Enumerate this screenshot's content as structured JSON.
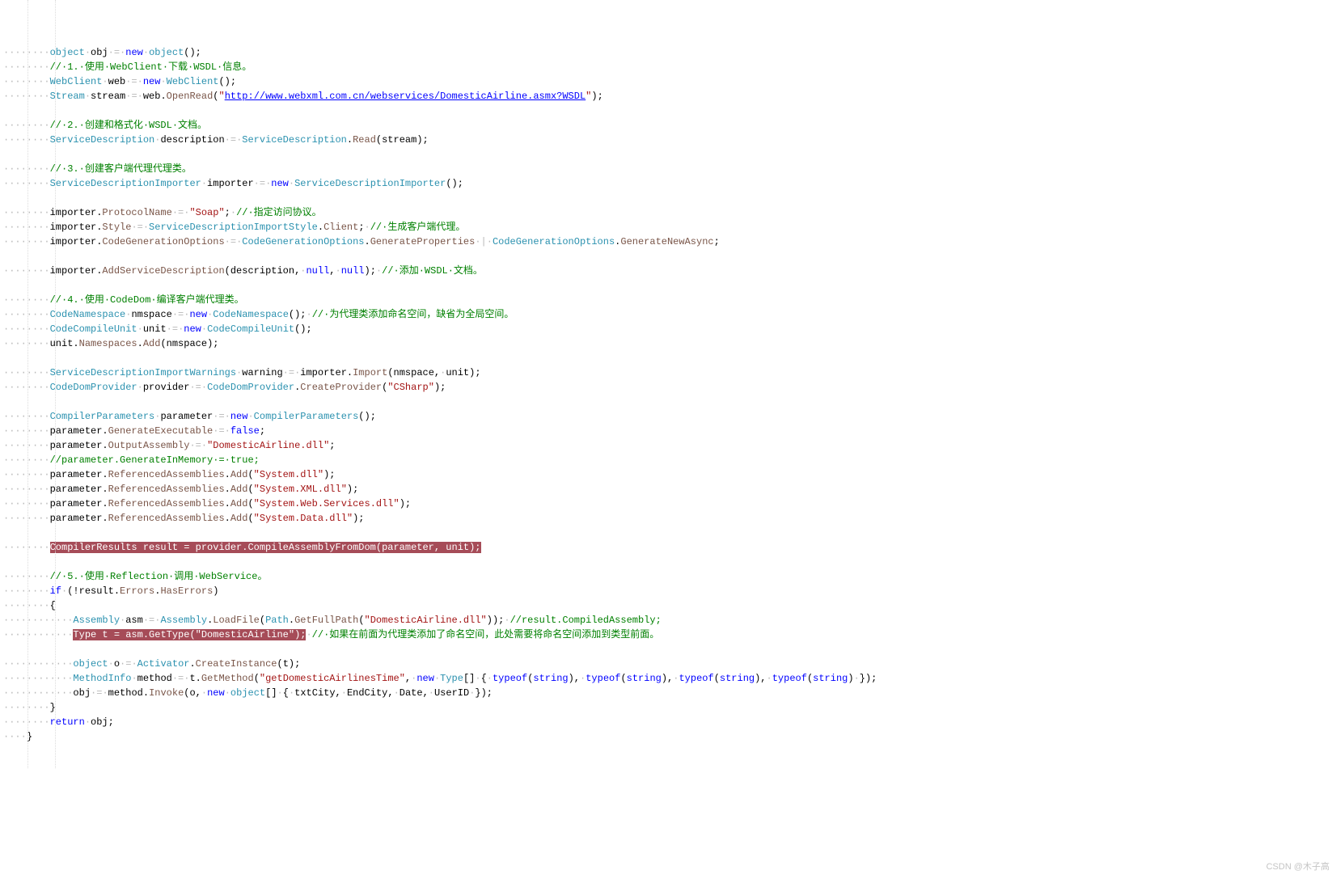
{
  "watermark": "CSDN @木子高",
  "lines": [
    [
      [
        "ws",
        "········"
      ],
      [
        "ty",
        "object"
      ],
      [
        "ws",
        "·"
      ],
      [
        "id",
        "obj"
      ],
      [
        "ws",
        "·="
      ],
      [
        "ws",
        "·"
      ],
      [
        "kw",
        "new"
      ],
      [
        "ws",
        "·"
      ],
      [
        "ty",
        "object"
      ],
      [
        "id",
        "();"
      ]
    ],
    [
      [
        "ws",
        "········"
      ],
      [
        "cm",
        "//·1.·使用·WebClient·下载·WSDL·信息。"
      ]
    ],
    [
      [
        "ws",
        "········"
      ],
      [
        "ty",
        "WebClient"
      ],
      [
        "ws",
        "·"
      ],
      [
        "id",
        "web"
      ],
      [
        "ws",
        "·="
      ],
      [
        "ws",
        "·"
      ],
      [
        "kw",
        "new"
      ],
      [
        "ws",
        "·"
      ],
      [
        "ty",
        "WebClient"
      ],
      [
        "id",
        "();"
      ]
    ],
    [
      [
        "ws",
        "········"
      ],
      [
        "ty",
        "Stream"
      ],
      [
        "ws",
        "·"
      ],
      [
        "id",
        "stream"
      ],
      [
        "ws",
        "·="
      ],
      [
        "ws",
        "·"
      ],
      [
        "id",
        "web."
      ],
      [
        "fn",
        "OpenRead"
      ],
      [
        "id",
        "("
      ],
      [
        "str",
        "\""
      ],
      [
        "url",
        "http://www.webxml.com.cn/webservices/DomesticAirline.asmx?WSDL"
      ],
      [
        "str",
        "\""
      ],
      [
        "id",
        ");"
      ]
    ],
    [
      [
        "ws",
        " "
      ]
    ],
    [
      [
        "ws",
        "········"
      ],
      [
        "cm",
        "//·2.·创建和格式化·WSDL·文档。"
      ]
    ],
    [
      [
        "ws",
        "········"
      ],
      [
        "ty",
        "ServiceDescription"
      ],
      [
        "ws",
        "·"
      ],
      [
        "id",
        "description"
      ],
      [
        "ws",
        "·="
      ],
      [
        "ws",
        "·"
      ],
      [
        "ty",
        "ServiceDescription"
      ],
      [
        "id",
        "."
      ],
      [
        "fn",
        "Read"
      ],
      [
        "id",
        "(stream);"
      ]
    ],
    [
      [
        "ws",
        " "
      ]
    ],
    [
      [
        "ws",
        "········"
      ],
      [
        "cm",
        "//·3.·创建客户端代理代理类。"
      ]
    ],
    [
      [
        "ws",
        "········"
      ],
      [
        "ty",
        "ServiceDescriptionImporter"
      ],
      [
        "ws",
        "·"
      ],
      [
        "id",
        "importer"
      ],
      [
        "ws",
        "·="
      ],
      [
        "ws",
        "·"
      ],
      [
        "kw",
        "new"
      ],
      [
        "ws",
        "·"
      ],
      [
        "ty",
        "ServiceDescriptionImporter"
      ],
      [
        "id",
        "();"
      ]
    ],
    [
      [
        "ws",
        " "
      ]
    ],
    [
      [
        "ws",
        "········"
      ],
      [
        "id",
        "importer."
      ],
      [
        "fn",
        "ProtocolName"
      ],
      [
        "ws",
        "·="
      ],
      [
        "ws",
        "·"
      ],
      [
        "str",
        "\"Soap\""
      ],
      [
        "id",
        ";"
      ],
      [
        "ws",
        "·"
      ],
      [
        "cm",
        "//·指定访问协议。"
      ]
    ],
    [
      [
        "ws",
        "········"
      ],
      [
        "id",
        "importer."
      ],
      [
        "fn",
        "Style"
      ],
      [
        "ws",
        "·="
      ],
      [
        "ws",
        "·"
      ],
      [
        "ty",
        "ServiceDescriptionImportStyle"
      ],
      [
        "id",
        "."
      ],
      [
        "fn",
        "Client"
      ],
      [
        "id",
        ";"
      ],
      [
        "ws",
        "·"
      ],
      [
        "cm",
        "//·生成客户端代理。"
      ]
    ],
    [
      [
        "ws",
        "········"
      ],
      [
        "id",
        "importer."
      ],
      [
        "fn",
        "CodeGenerationOptions"
      ],
      [
        "ws",
        "·="
      ],
      [
        "ws",
        "·"
      ],
      [
        "ty",
        "CodeGenerationOptions"
      ],
      [
        "id",
        "."
      ],
      [
        "fn",
        "GenerateProperties"
      ],
      [
        "ws",
        "·|·"
      ],
      [
        "ty",
        "CodeGenerationOptions"
      ],
      [
        "id",
        "."
      ],
      [
        "fn",
        "GenerateNewAsync"
      ],
      [
        "id",
        ";"
      ]
    ],
    [
      [
        "ws",
        " "
      ]
    ],
    [
      [
        "ws",
        "········"
      ],
      [
        "id",
        "importer."
      ],
      [
        "fn",
        "AddServiceDescription"
      ],
      [
        "id",
        "(description,"
      ],
      [
        "ws",
        "·"
      ],
      [
        "kw",
        "null"
      ],
      [
        "id",
        ","
      ],
      [
        "ws",
        "·"
      ],
      [
        "kw",
        "null"
      ],
      [
        "id",
        ");"
      ],
      [
        "ws",
        "·"
      ],
      [
        "cm",
        "//·添加·WSDL·文档。"
      ]
    ],
    [
      [
        "ws",
        " "
      ]
    ],
    [
      [
        "ws",
        "········"
      ],
      [
        "cm",
        "//·4.·使用·CodeDom·编译客户端代理类。"
      ]
    ],
    [
      [
        "ws",
        "········"
      ],
      [
        "ty",
        "CodeNamespace"
      ],
      [
        "ws",
        "·"
      ],
      [
        "id",
        "nmspace"
      ],
      [
        "ws",
        "·="
      ],
      [
        "ws",
        "·"
      ],
      [
        "kw",
        "new"
      ],
      [
        "ws",
        "·"
      ],
      [
        "ty",
        "CodeNamespace"
      ],
      [
        "id",
        "();"
      ],
      [
        "ws",
        "·"
      ],
      [
        "cm",
        "//·为代理类添加命名空间，缺省为全局空间。"
      ]
    ],
    [
      [
        "ws",
        "········"
      ],
      [
        "ty",
        "CodeCompileUnit"
      ],
      [
        "ws",
        "·"
      ],
      [
        "id",
        "unit"
      ],
      [
        "ws",
        "·="
      ],
      [
        "ws",
        "·"
      ],
      [
        "kw",
        "new"
      ],
      [
        "ws",
        "·"
      ],
      [
        "ty",
        "CodeCompileUnit"
      ],
      [
        "id",
        "();"
      ]
    ],
    [
      [
        "ws",
        "········"
      ],
      [
        "id",
        "unit."
      ],
      [
        "fn",
        "Namespaces"
      ],
      [
        "id",
        "."
      ],
      [
        "fn",
        "Add"
      ],
      [
        "id",
        "(nmspace);"
      ]
    ],
    [
      [
        "ws",
        " "
      ]
    ],
    [
      [
        "ws",
        "········"
      ],
      [
        "ty",
        "ServiceDescriptionImportWarnings"
      ],
      [
        "ws",
        "·"
      ],
      [
        "id",
        "warning"
      ],
      [
        "ws",
        "·="
      ],
      [
        "ws",
        "·"
      ],
      [
        "id",
        "importer."
      ],
      [
        "fn",
        "Import"
      ],
      [
        "id",
        "(nmspace,"
      ],
      [
        "ws",
        "·"
      ],
      [
        "id",
        "unit);"
      ]
    ],
    [
      [
        "ws",
        "········"
      ],
      [
        "ty",
        "CodeDomProvider"
      ],
      [
        "ws",
        "·"
      ],
      [
        "id",
        "provider"
      ],
      [
        "ws",
        "·="
      ],
      [
        "ws",
        "·"
      ],
      [
        "ty",
        "CodeDomProvider"
      ],
      [
        "id",
        "."
      ],
      [
        "fn",
        "CreateProvider"
      ],
      [
        "id",
        "("
      ],
      [
        "str",
        "\"CSharp\""
      ],
      [
        "id",
        ");"
      ]
    ],
    [
      [
        "ws",
        " "
      ]
    ],
    [
      [
        "ws",
        "········"
      ],
      [
        "ty",
        "CompilerParameters"
      ],
      [
        "ws",
        "·"
      ],
      [
        "id",
        "parameter"
      ],
      [
        "ws",
        "·="
      ],
      [
        "ws",
        "·"
      ],
      [
        "kw",
        "new"
      ],
      [
        "ws",
        "·"
      ],
      [
        "ty",
        "CompilerParameters"
      ],
      [
        "id",
        "();"
      ]
    ],
    [
      [
        "ws",
        "········"
      ],
      [
        "id",
        "parameter."
      ],
      [
        "fn",
        "GenerateExecutable"
      ],
      [
        "ws",
        "·="
      ],
      [
        "ws",
        "·"
      ],
      [
        "kw",
        "false"
      ],
      [
        "id",
        ";"
      ]
    ],
    [
      [
        "ws",
        "········"
      ],
      [
        "id",
        "parameter."
      ],
      [
        "fn",
        "OutputAssembly"
      ],
      [
        "ws",
        "·="
      ],
      [
        "ws",
        "·"
      ],
      [
        "str",
        "\"DomesticAirline.dll\""
      ],
      [
        "id",
        ";"
      ]
    ],
    [
      [
        "ws",
        "········"
      ],
      [
        "cm",
        "//parameter.GenerateInMemory·=·true;"
      ]
    ],
    [
      [
        "ws",
        "········"
      ],
      [
        "id",
        "parameter."
      ],
      [
        "fn",
        "ReferencedAssemblies"
      ],
      [
        "id",
        "."
      ],
      [
        "fn",
        "Add"
      ],
      [
        "id",
        "("
      ],
      [
        "str",
        "\"System.dll\""
      ],
      [
        "id",
        ");"
      ]
    ],
    [
      [
        "ws",
        "········"
      ],
      [
        "id",
        "parameter."
      ],
      [
        "fn",
        "ReferencedAssemblies"
      ],
      [
        "id",
        "."
      ],
      [
        "fn",
        "Add"
      ],
      [
        "id",
        "("
      ],
      [
        "str",
        "\"System.XML.dll\""
      ],
      [
        "id",
        ");"
      ]
    ],
    [
      [
        "ws",
        "········"
      ],
      [
        "id",
        "parameter."
      ],
      [
        "fn",
        "ReferencedAssemblies"
      ],
      [
        "id",
        "."
      ],
      [
        "fn",
        "Add"
      ],
      [
        "id",
        "("
      ],
      [
        "str",
        "\"System.Web.Services.dll\""
      ],
      [
        "id",
        ");"
      ]
    ],
    [
      [
        "ws",
        "········"
      ],
      [
        "id",
        "parameter."
      ],
      [
        "fn",
        "ReferencedAssemblies"
      ],
      [
        "id",
        "."
      ],
      [
        "fn",
        "Add"
      ],
      [
        "id",
        "("
      ],
      [
        "str",
        "\"System.Data.dll\""
      ],
      [
        "id",
        ");"
      ]
    ],
    [
      [
        "ws",
        " "
      ]
    ],
    [
      [
        "ws",
        "········"
      ],
      [
        "hl",
        "CompilerResults result = provider.CompileAssemblyFromDom(parameter, unit);"
      ]
    ],
    [
      [
        "ws",
        " "
      ]
    ],
    [
      [
        "ws",
        "········"
      ],
      [
        "cm",
        "//·5.·使用·Reflection·调用·WebService。"
      ]
    ],
    [
      [
        "ws",
        "········"
      ],
      [
        "kw",
        "if"
      ],
      [
        "ws",
        "·"
      ],
      [
        "id",
        "(!result."
      ],
      [
        "fn",
        "Errors"
      ],
      [
        "id",
        "."
      ],
      [
        "fn",
        "HasErrors"
      ],
      [
        "id",
        ")"
      ]
    ],
    [
      [
        "ws",
        "········"
      ],
      [
        "id",
        "{"
      ]
    ],
    [
      [
        "ws",
        "············"
      ],
      [
        "ty",
        "Assembly"
      ],
      [
        "ws",
        "·"
      ],
      [
        "id",
        "asm"
      ],
      [
        "ws",
        "·="
      ],
      [
        "ws",
        "·"
      ],
      [
        "ty",
        "Assembly"
      ],
      [
        "id",
        "."
      ],
      [
        "fn",
        "LoadFile"
      ],
      [
        "id",
        "("
      ],
      [
        "ty",
        "Path"
      ],
      [
        "id",
        "."
      ],
      [
        "fn",
        "GetFullPath"
      ],
      [
        "id",
        "("
      ],
      [
        "str",
        "\"DomesticAirline.dll\""
      ],
      [
        "id",
        "));"
      ],
      [
        "ws",
        "·"
      ],
      [
        "cm",
        "//result.CompiledAssembly;"
      ]
    ],
    [
      [
        "ws",
        "············"
      ],
      [
        "hl",
        "Type t = asm.GetType(\"DomesticAirline\");"
      ],
      [
        "ws",
        "·"
      ],
      [
        "cm",
        "//·如果在前面为代理类添加了命名空间，此处需要将命名空间添加到类型前面。"
      ]
    ],
    [
      [
        "ws",
        " "
      ]
    ],
    [
      [
        "ws",
        "············"
      ],
      [
        "ty",
        "object"
      ],
      [
        "ws",
        "·"
      ],
      [
        "id",
        "o"
      ],
      [
        "ws",
        "·="
      ],
      [
        "ws",
        "·"
      ],
      [
        "ty",
        "Activator"
      ],
      [
        "id",
        "."
      ],
      [
        "fn",
        "CreateInstance"
      ],
      [
        "id",
        "(t);"
      ]
    ],
    [
      [
        "ws",
        "············"
      ],
      [
        "ty",
        "MethodInfo"
      ],
      [
        "ws",
        "·"
      ],
      [
        "id",
        "method"
      ],
      [
        "ws",
        "·="
      ],
      [
        "ws",
        "·"
      ],
      [
        "id",
        "t."
      ],
      [
        "fn",
        "GetMethod"
      ],
      [
        "id",
        "("
      ],
      [
        "str",
        "\"getDomesticAirlinesTime\""
      ],
      [
        "id",
        ","
      ],
      [
        "ws",
        "·"
      ],
      [
        "kw",
        "new"
      ],
      [
        "ws",
        "·"
      ],
      [
        "ty",
        "Type"
      ],
      [
        "id",
        "[]"
      ],
      [
        "ws",
        "·"
      ],
      [
        "id",
        "{"
      ],
      [
        "ws",
        "·"
      ],
      [
        "kw",
        "typeof"
      ],
      [
        "id",
        "("
      ],
      [
        "kw",
        "string"
      ],
      [
        "id",
        "),"
      ],
      [
        "ws",
        "·"
      ],
      [
        "kw",
        "typeof"
      ],
      [
        "id",
        "("
      ],
      [
        "kw",
        "string"
      ],
      [
        "id",
        "),"
      ],
      [
        "ws",
        "·"
      ],
      [
        "kw",
        "typeof"
      ],
      [
        "id",
        "("
      ],
      [
        "kw",
        "string"
      ],
      [
        "id",
        "),"
      ],
      [
        "ws",
        "·"
      ],
      [
        "kw",
        "typeof"
      ],
      [
        "id",
        "("
      ],
      [
        "kw",
        "string"
      ],
      [
        "id",
        ")"
      ],
      [
        "ws",
        "·"
      ],
      [
        "id",
        "});"
      ]
    ],
    [
      [
        "ws",
        "············"
      ],
      [
        "id",
        "obj"
      ],
      [
        "ws",
        "·="
      ],
      [
        "ws",
        "·"
      ],
      [
        "id",
        "method."
      ],
      [
        "fn",
        "Invoke"
      ],
      [
        "id",
        "(o,"
      ],
      [
        "ws",
        "·"
      ],
      [
        "kw",
        "new"
      ],
      [
        "ws",
        "·"
      ],
      [
        "ty",
        "object"
      ],
      [
        "id",
        "[]"
      ],
      [
        "ws",
        "·"
      ],
      [
        "id",
        "{"
      ],
      [
        "ws",
        "·"
      ],
      [
        "id",
        "txtCity,"
      ],
      [
        "ws",
        "·"
      ],
      [
        "id",
        "EndCity,"
      ],
      [
        "ws",
        "·"
      ],
      [
        "id",
        "Date,"
      ],
      [
        "ws",
        "·"
      ],
      [
        "id",
        "UserID"
      ],
      [
        "ws",
        "·"
      ],
      [
        "id",
        "});"
      ]
    ],
    [
      [
        "ws",
        "········"
      ],
      [
        "id",
        "}"
      ]
    ],
    [
      [
        "ws",
        "········"
      ],
      [
        "kw",
        "return"
      ],
      [
        "ws",
        "·"
      ],
      [
        "id",
        "obj;"
      ]
    ],
    [
      [
        "ws",
        "····"
      ],
      [
        "id",
        "}"
      ]
    ]
  ]
}
